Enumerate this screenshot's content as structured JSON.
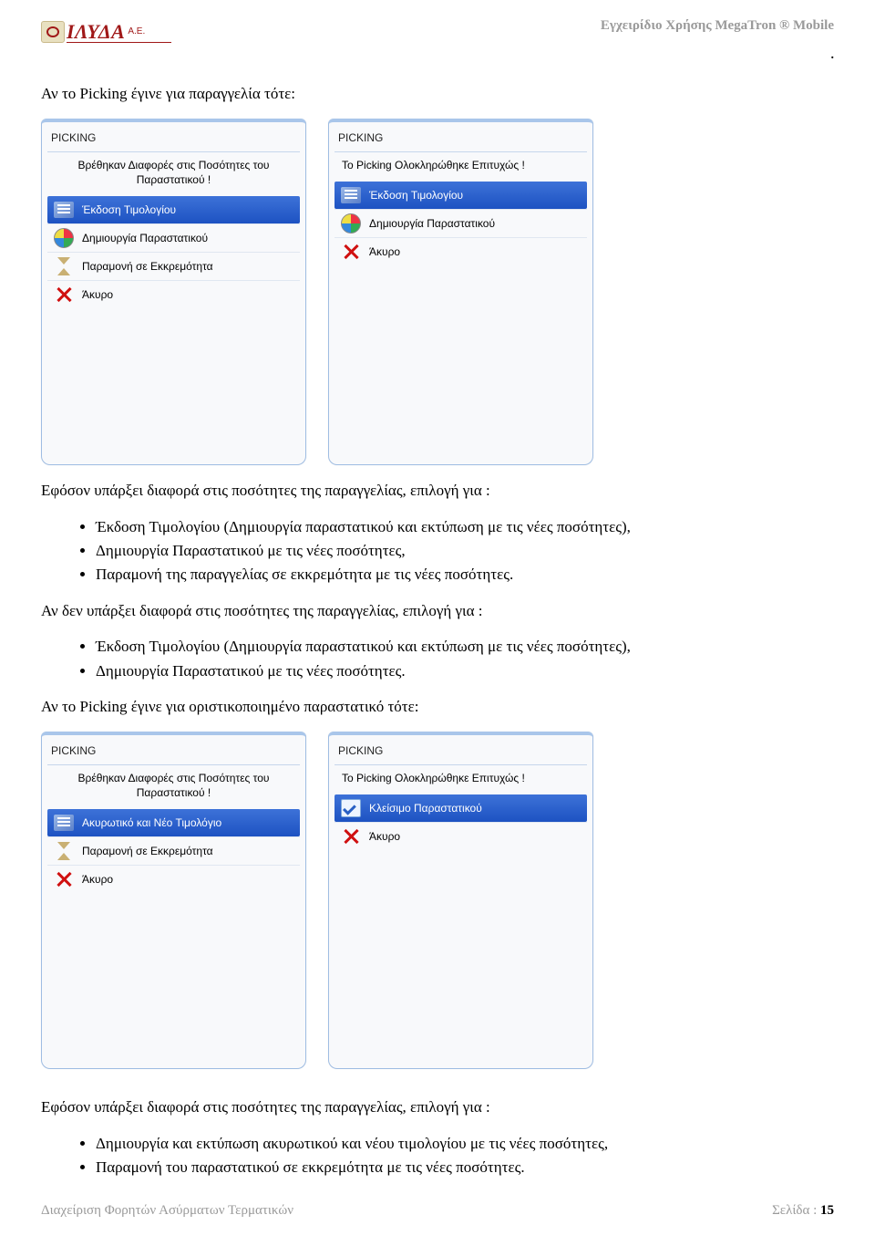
{
  "header": {
    "logo_text": "ΙΛΥΔΑ",
    "logo_suffix": "Α.Ε.",
    "doc_title": "Εγχειρίδιο Χρήσης MegaTron ® Mobile"
  },
  "intro1": "Αν το Picking έγινε για παραγγελία τότε:",
  "shots1": {
    "left": {
      "title": "PICKING",
      "message": "Βρέθηκαν Διαφορές στις Ποσότητες του Παραστατικού !",
      "items": [
        "Έκδοση Τιμολογίου",
        "Δημιουργία Παραστατικού",
        "Παραμονή σε Εκκρεμότητα",
        "Άκυρο"
      ]
    },
    "right": {
      "title": "PICKING",
      "message": "Το Picking Ολοκληρώθηκε Επιτυχώς !",
      "items": [
        "Έκδοση Τιμολογίου",
        "Δημιουργία Παραστατικού",
        "Άκυρο"
      ]
    }
  },
  "para1": "Εφόσον υπάρξει διαφορά στις ποσότητες της παραγγελίας, επιλογή για :",
  "list1": [
    "Έκδοση Τιμολογίου (Δημιουργία παραστατικού και εκτύπωση με τις νέες ποσότητες),",
    "Δημιουργία Παραστατικού με τις νέες ποσότητες,",
    "Παραμονή της παραγγελίας σε εκκρεμότητα με τις νέες ποσότητες."
  ],
  "para2": "Αν δεν υπάρξει διαφορά στις ποσότητες της παραγγελίας, επιλογή για :",
  "list2": [
    "Έκδοση Τιμολογίου (Δημιουργία παραστατικού και εκτύπωση με τις νέες ποσότητες),",
    "Δημιουργία Παραστατικού με τις νέες ποσότητες."
  ],
  "intro2": "Αν το Picking έγινε για οριστικοποιημένο παραστατικό τότε:",
  "shots2": {
    "left": {
      "title": "PICKING",
      "message": "Βρέθηκαν Διαφορές στις Ποσότητες του Παραστατικού !",
      "items": [
        "Ακυρωτικό και Νέο Τιμολόγιο",
        "Παραμονή σε Εκκρεμότητα",
        "Άκυρο"
      ]
    },
    "right": {
      "title": "PICKING",
      "message": "Το Picking Ολοκληρώθηκε Επιτυχώς !",
      "items": [
        "Κλείσιμο Παραστατικού",
        "Άκυρο"
      ]
    }
  },
  "para3": "Εφόσον υπάρξει διαφορά στις ποσότητες της παραγγελίας, επιλογή για :",
  "list3": [
    "Δημιουργία και εκτύπωση ακυρωτικού και νέου τιμολογίου με τις νέες ποσότητες,",
    "Παραμονή του παραστατικού σε εκκρεμότητα με τις νέες ποσότητες."
  ],
  "footer": {
    "left": "Διαχείριση Φορητών Ασύρματων Τερματικών",
    "right_label": "Σελίδα : ",
    "page": "15"
  }
}
